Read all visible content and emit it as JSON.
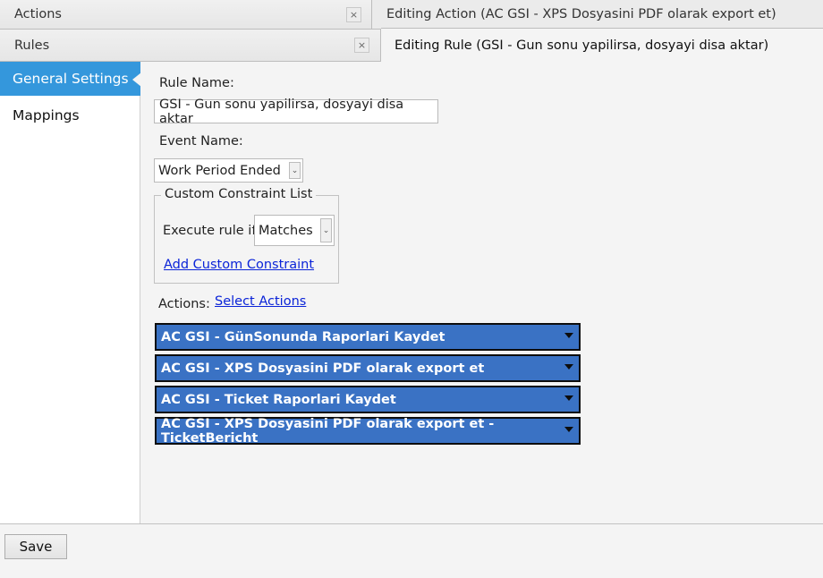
{
  "tabs": {
    "row1": [
      {
        "label": "Actions",
        "closable": true,
        "close_icon": "×"
      },
      {
        "label": "Editing Action (AC GSI - XPS Dosyasini PDF olarak export et)",
        "active": false
      }
    ],
    "row2": [
      {
        "label": "Rules",
        "closable": true,
        "close_icon": "×"
      },
      {
        "label": "Editing Rule (GSI - Gun sonu yapilirsa,  dosyayi disa aktar)",
        "active": true
      }
    ]
  },
  "sidebar": {
    "items": [
      {
        "label": "General Settings",
        "active": true
      },
      {
        "label": "Mappings",
        "active": false
      }
    ],
    "active_color": "#3497dc"
  },
  "form": {
    "rule_name_label": "Rule Name:",
    "rule_name_value": "GSI - Gun sonu yapilirsa,  dosyayi disa aktar",
    "event_name_label": "Event Name:",
    "event_name_value": "Work Period Ended",
    "constraint_group_label": "Custom Constraint List",
    "execute_rule_label": "Execute rule if",
    "execute_rule_value": "Matches",
    "add_constraint_link": "Add Custom Constraint",
    "actions_label": "Actions:",
    "select_actions_link": "Select Actions",
    "dropdown_glyph": "⌄"
  },
  "actions": [
    {
      "label": "AC GSI - GünSonunda Raporlari Kaydet"
    },
    {
      "label": "AC GSI - XPS Dosyasini PDF olarak export et"
    },
    {
      "label": "AC GSI - Ticket Raporlari Kaydet"
    },
    {
      "label": "AC GSI - XPS Dosyasini PDF olarak export et - TicketBericht"
    }
  ],
  "action_color": "#3a72c4",
  "footer": {
    "save_label": "Save"
  }
}
